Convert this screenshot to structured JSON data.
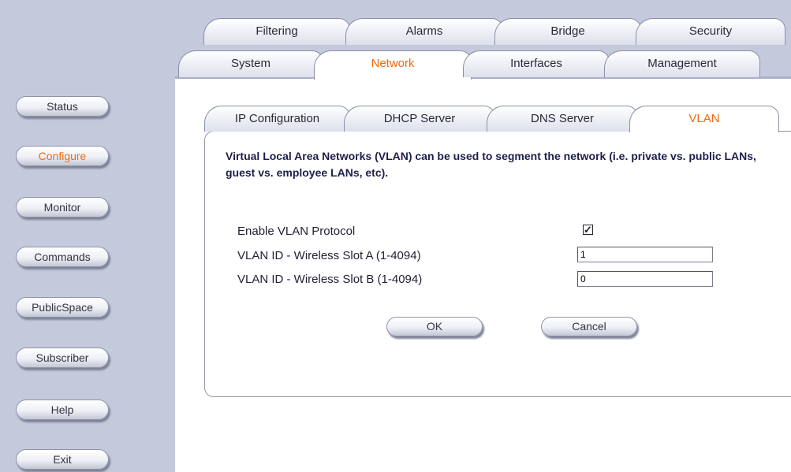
{
  "sidebar": {
    "items": [
      {
        "label": "Status"
      },
      {
        "label": "Configure"
      },
      {
        "label": "Monitor"
      },
      {
        "label": "Commands"
      },
      {
        "label": "PublicSpace"
      },
      {
        "label": "Subscriber"
      },
      {
        "label": "Help"
      },
      {
        "label": "Exit"
      }
    ],
    "active": "Configure"
  },
  "top_tabs": {
    "row1": [
      {
        "label": "Filtering"
      },
      {
        "label": "Alarms"
      },
      {
        "label": "Bridge"
      },
      {
        "label": "Security"
      }
    ],
    "row2": [
      {
        "label": "System"
      },
      {
        "label": "Network"
      },
      {
        "label": "Interfaces"
      },
      {
        "label": "Management"
      }
    ],
    "active": "Network"
  },
  "sub_tabs": {
    "items": [
      {
        "label": "IP Configuration"
      },
      {
        "label": "DHCP Server"
      },
      {
        "label": "DNS Server"
      },
      {
        "label": "VLAN"
      }
    ],
    "active": "VLAN"
  },
  "vlan": {
    "description": "Virtual Local Area Networks (VLAN) can be used to segment the network (i.e. private vs. public LANs, guest vs. employee LANs, etc).",
    "enable_label": "Enable VLAN Protocol",
    "enable_checked": true,
    "check_mark": "✓",
    "slot_a_label": "VLAN ID - Wireless Slot A (1-4094)",
    "slot_a_value": "1",
    "slot_b_label": "VLAN ID - Wireless Slot B (1-4094)",
    "slot_b_value": "0"
  },
  "buttons": {
    "ok": "OK",
    "cancel": "Cancel"
  },
  "colors": {
    "accent": "#f06a10",
    "sidebar_bg": "#c4c9dc",
    "heading_text": "#1c1f4a"
  }
}
